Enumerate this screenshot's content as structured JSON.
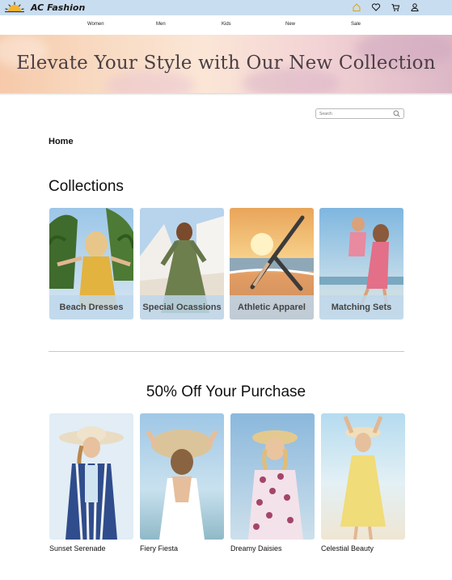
{
  "header": {
    "brand": "AC Fashion",
    "icons": [
      "home-icon",
      "heart-icon",
      "cart-icon",
      "user-icon"
    ]
  },
  "nav": {
    "items": [
      {
        "label": "Women"
      },
      {
        "label": "Men"
      },
      {
        "label": "Kids"
      },
      {
        "label": "New"
      },
      {
        "label": "Sale"
      }
    ]
  },
  "hero": {
    "headline": "Elevate Your Style with Our New Collection"
  },
  "search": {
    "placeholder": "Search"
  },
  "breadcrumb": "Home",
  "collections": {
    "title": "Collections",
    "items": [
      {
        "label": "Beach Dresses"
      },
      {
        "label": "Special Ocassions"
      },
      {
        "label": "Athletic Apparel"
      },
      {
        "label": "Matching Sets"
      }
    ]
  },
  "promo": {
    "title": "50% Off Your Purchase",
    "products": [
      {
        "name": "Sunset Serenade"
      },
      {
        "name": "Fiery Fiesta"
      },
      {
        "name": "Dreamy Daisies"
      },
      {
        "name": "Celestial Beauty"
      }
    ]
  },
  "colors": {
    "topbar": "#c9ddf0",
    "label_overlay": "#bed7eb",
    "hero_text": "#4b3f45"
  }
}
